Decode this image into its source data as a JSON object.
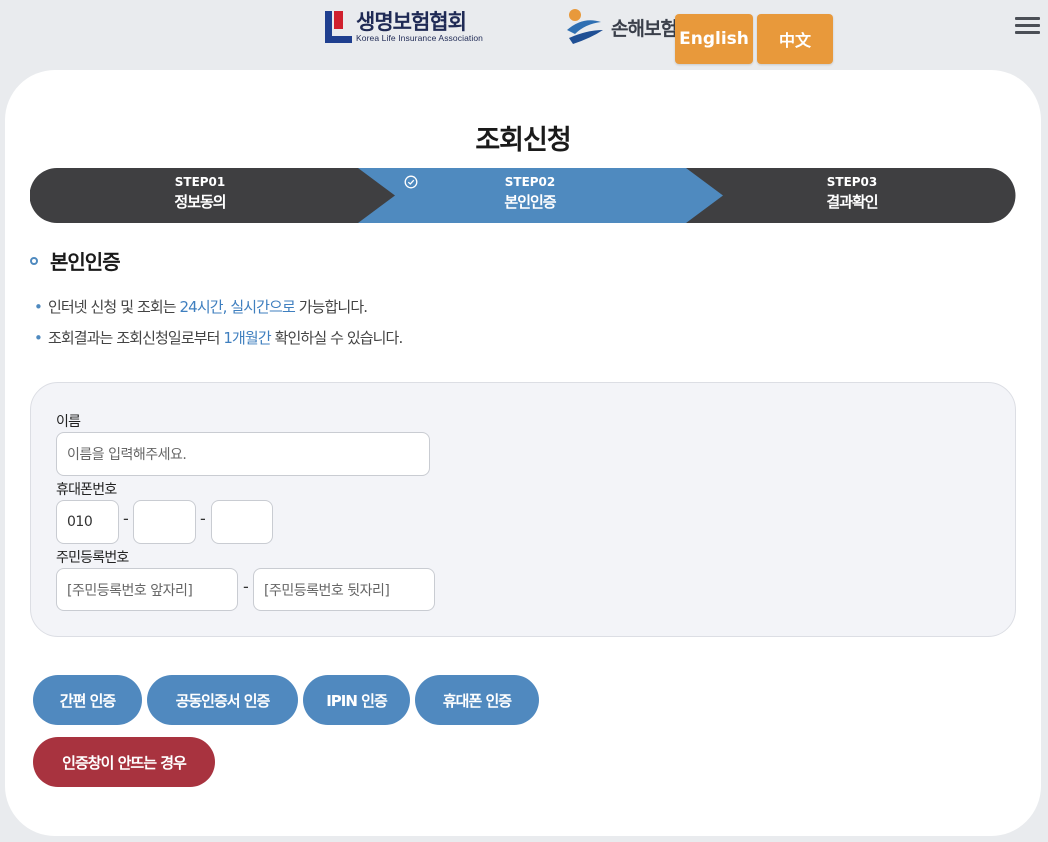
{
  "header": {
    "logo_klia": {
      "ko": "생명보험협회",
      "en": "Korea Life Insurance Association"
    },
    "logo_gia": {
      "ko": "손해보험"
    },
    "lang_english": "English",
    "lang_chinese": "中文"
  },
  "page": {
    "title": "조회신청",
    "steps": [
      {
        "num": "STEP01",
        "name": "정보동의"
      },
      {
        "num": "STEP02",
        "name": "본인인증"
      },
      {
        "num": "STEP03",
        "name": "결과확인"
      }
    ],
    "section_title": "본인인증",
    "notes": [
      {
        "pre": "인터넷 신청 및 조회는 ",
        "hl": "24시간, 실시간으로",
        "post": " 가능합니다."
      },
      {
        "pre": "조회결과는 조회신청일로부터 ",
        "hl": "1개월간",
        "post": " 확인하실 수 있습니다."
      }
    ],
    "colors": {
      "step_dark": "#3f3f41",
      "step_active": "#4f8abf",
      "accent_blue": "#5089bf",
      "accent_red": "#a8333f",
      "lang_orange": "#e8993b"
    }
  },
  "form": {
    "name_label": "이름",
    "name_placeholder": "이름을 입력해주세요.",
    "phone_label": "휴대폰번호",
    "phone_prefix": "010",
    "phone_dash": "-",
    "rrn_label": "주민등록번호",
    "rrn_front_placeholder": "[주민등록번호 앞자리]",
    "rrn_back_placeholder": "[주민등록번호 뒷자리]"
  },
  "buttons": {
    "simple": "간편 인증",
    "cert": "공동인증서 인증",
    "ipin": "IPIN 인증",
    "phone": "휴대폰 인증",
    "popup_help": "인증창이 안뜨는 경우"
  }
}
